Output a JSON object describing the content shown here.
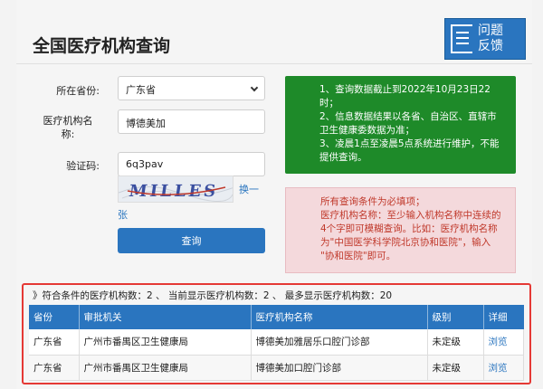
{
  "page": {
    "title": "全国医疗机构查询",
    "feedback_label_line1": "问题",
    "feedback_label_line2": "反馈"
  },
  "form": {
    "province_label": "所在省份:",
    "province_value": "广东省",
    "institution_label_line1": "医疗机构名",
    "institution_label_line2": "称:",
    "institution_value": "博德美加",
    "captcha_label": "验证码:",
    "captcha_value": "6q3pav",
    "captcha_image_text": "MILLES",
    "swap_label_part1": "换一",
    "swap_label_part2": "张",
    "query_button": "查询"
  },
  "notice_green": {
    "line1": "1、查询数据截止到2022年10月23日22",
    "line2": "时；",
    "line3": "2、信息数据结果以各省、自治区、直辖市",
    "line4": "卫生健康委数据为准；",
    "line5": "3、凌晨1点至凌晨5点系统进行维护，不能",
    "line6": "提供查询。"
  },
  "notice_pink": {
    "line1": "所有查询条件为必填项；",
    "line2": "医疗机构名称：至少输入机构名称中连续的",
    "line3": "4个字即可模糊查询。比如：医疗机构名称",
    "line4": "为\"中国医学科学院北京协和医院\"，输入",
    "line5": "\"协和医院\"即可。"
  },
  "results": {
    "summary": "》符合条件的医疗机构数：2 、 当前显示医疗机构数：2 、 最多显示医疗机构数：20",
    "headers": [
      "省份",
      "审批机关",
      "医疗机构名称",
      "级别",
      "详细"
    ],
    "rows": [
      [
        "广东省",
        "广州市番禺区卫生健康局",
        "博德美加雅居乐口腔门诊部",
        "未定级",
        "浏览"
      ],
      [
        "广东省",
        "广州市番禺区卫生健康局",
        "博德美加口腔门诊部",
        "未定级",
        "浏览"
      ]
    ]
  },
  "colors": {
    "primary_blue": "#2a75bf",
    "notice_green": "#1e8a29",
    "notice_pink_bg": "#f4d9dc",
    "highlight_red": "#e53935"
  }
}
